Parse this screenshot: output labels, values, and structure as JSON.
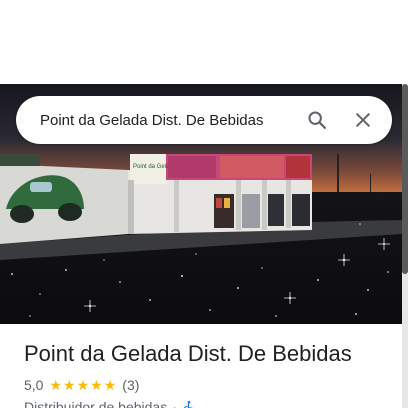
{
  "search": {
    "query": "Point da Gelada Dist. De Bebidas"
  },
  "icons": {
    "search": "search-icon",
    "close": "close-icon",
    "star": "star-icon",
    "accessibility": "wheelchair-icon"
  },
  "colors": {
    "star": "#fbbc04",
    "accessibility": "#1a73e8",
    "title_text": "#202124",
    "secondary_text": "#5f6368",
    "icon_gray": "#5f6368"
  },
  "hero": {
    "sign_text": "Point da Gelada"
  },
  "place": {
    "name": "Point da Gelada Dist. De Bebidas",
    "rating": "5,0",
    "stars": 5,
    "review_count": "(3)",
    "category": "Distribuidor de bebidas",
    "separator": "·"
  }
}
